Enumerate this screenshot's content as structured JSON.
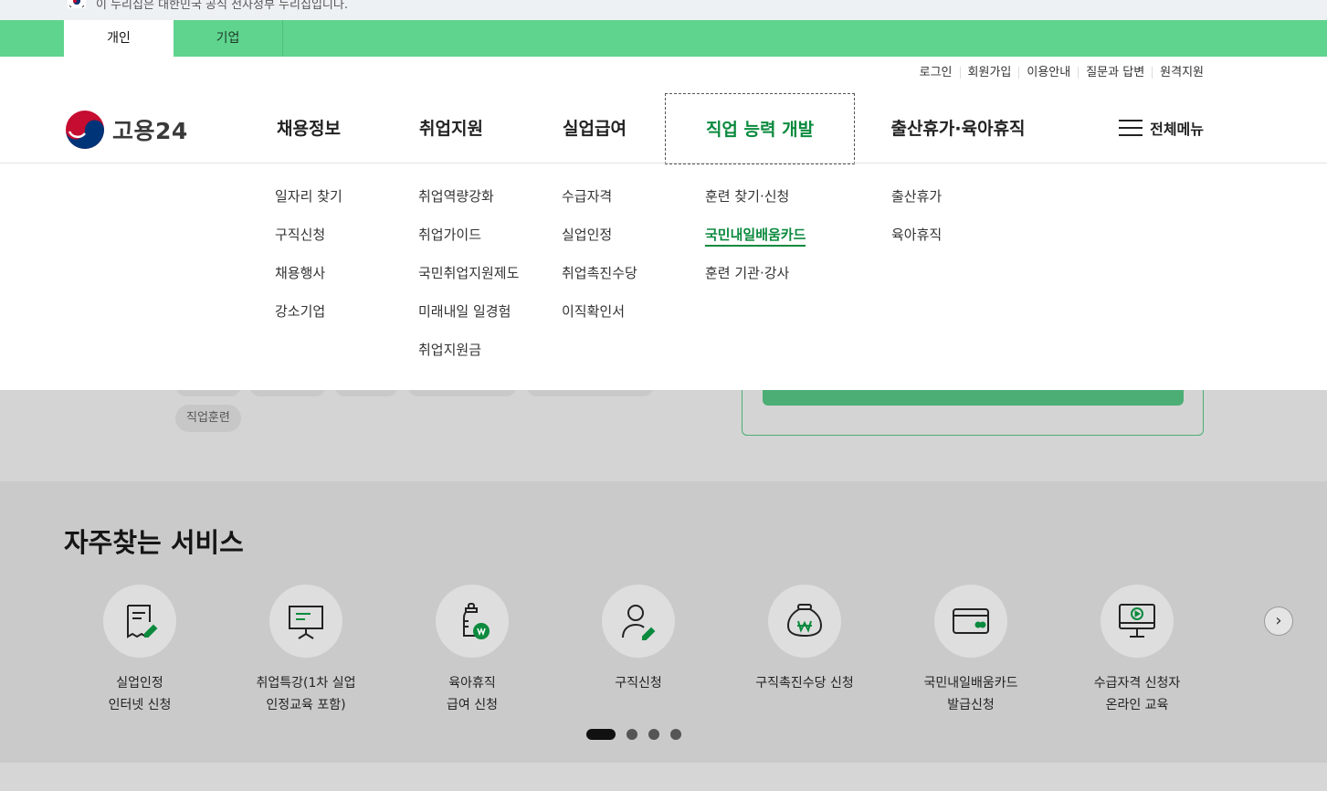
{
  "gov_banner": {
    "text": "이 누리집은 대한민국 공식 전자정부 누리집입니다."
  },
  "user_types": [
    {
      "label": "개인",
      "active": true
    },
    {
      "label": "기업",
      "active": false
    }
  ],
  "utility_links": [
    "로그인",
    "회원가입",
    "이용안내",
    "질문과 답변",
    "원격지원"
  ],
  "logo": {
    "text": "고용24"
  },
  "gnb": [
    {
      "label": "채용정보",
      "sub": [
        "일자리 찾기",
        "구직신청",
        "채용행사",
        "강소기업"
      ]
    },
    {
      "label": "취업지원",
      "sub": [
        "취업역량강화",
        "취업가이드",
        "국민취업지원제도",
        "미래내일 일경험",
        "취업지원금"
      ]
    },
    {
      "label": "실업급여",
      "sub": [
        "수급자격",
        "실업인정",
        "취업촉진수당",
        "이직확인서"
      ]
    },
    {
      "label": "직업 능력 개발",
      "active": true,
      "sub": [
        "훈련 찾기·신청",
        "국민내일배움카드",
        "훈련 기관·강사"
      ],
      "current_sub": 1
    },
    {
      "label": "출산휴가·육아휴직",
      "sub": [
        "출산휴가",
        "육아휴직"
      ]
    }
  ],
  "all_menu_label": "전체메뉴",
  "background": {
    "chip_label": "직업훈련"
  },
  "services": {
    "title": "자주찾는 서비스",
    "items": [
      {
        "line1": "실업인정",
        "line2": "인터넷 신청",
        "icon": "document-pen-icon"
      },
      {
        "line1": "취업특강(1차 실업",
        "line2": "인정교육 포함)",
        "icon": "presentation-board-icon"
      },
      {
        "line1": "육아휴직",
        "line2": "급여 신청",
        "icon": "baby-bottle-won-icon"
      },
      {
        "line1": "구직신청",
        "line2": "",
        "icon": "person-pen-icon"
      },
      {
        "line1": "구직촉진수당 신청",
        "line2": "",
        "icon": "money-bag-won-icon"
      },
      {
        "line1": "국민내일배움카드",
        "line2": "발급신청",
        "icon": "card-icon"
      },
      {
        "line1": "수급자격 신청자",
        "line2": "온라인 교육",
        "icon": "monitor-play-icon"
      }
    ],
    "pagination": {
      "pages": 4,
      "current": 1
    }
  },
  "colors": {
    "primary_green": "#5fd48e",
    "active_text": "#0b8a3e",
    "button_green": "#4cae74"
  }
}
